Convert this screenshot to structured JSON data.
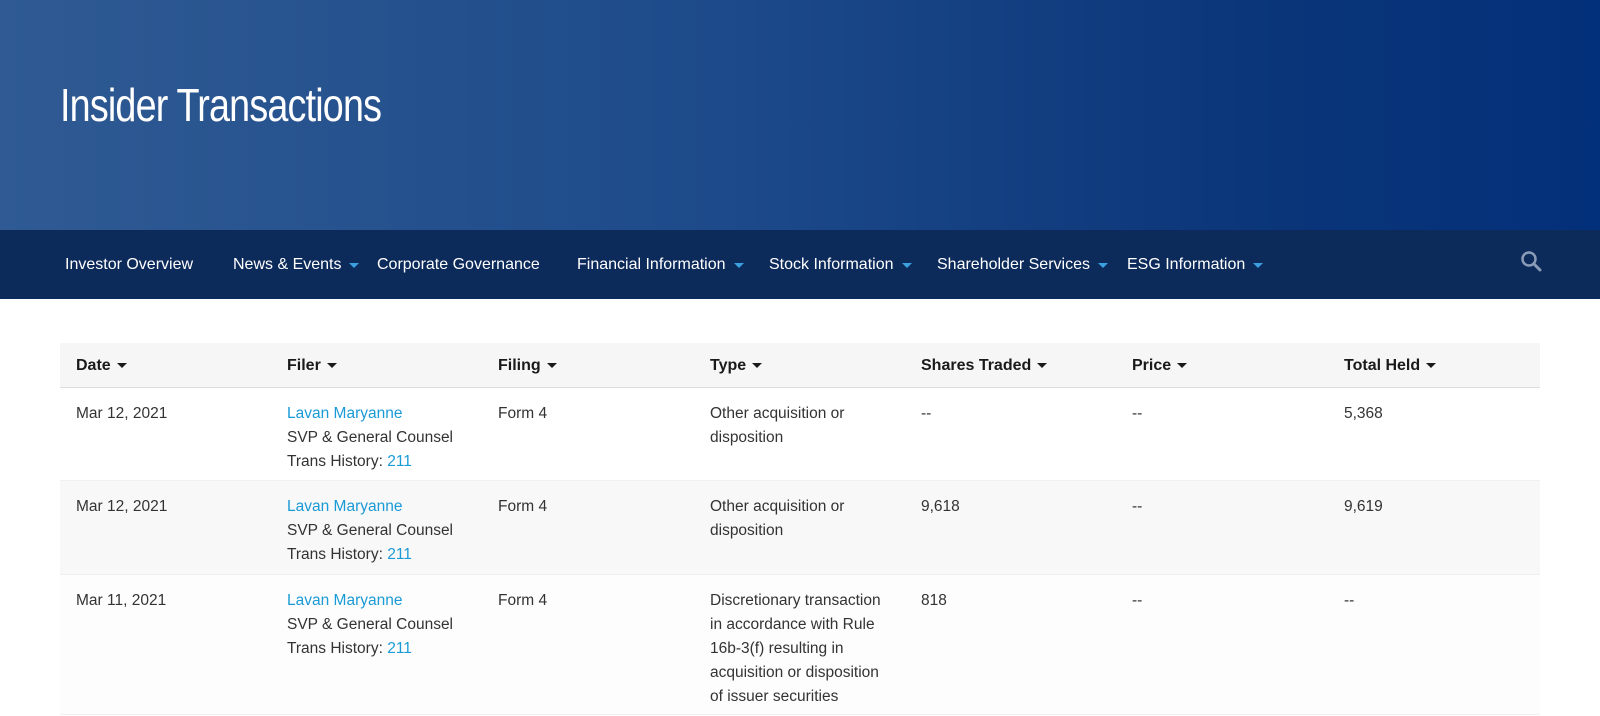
{
  "header": {
    "title": "Insider Transactions"
  },
  "nav": {
    "items": [
      {
        "label": "Investor Overview",
        "has_dropdown": false
      },
      {
        "label": "News & Events",
        "has_dropdown": true
      },
      {
        "label": "Corporate Governance",
        "has_dropdown": false
      },
      {
        "label": "Financial Information",
        "has_dropdown": true
      },
      {
        "label": "Stock Information",
        "has_dropdown": true
      },
      {
        "label": "Shareholder Services",
        "has_dropdown": true
      },
      {
        "label": "ESG Information",
        "has_dropdown": true
      }
    ],
    "search_icon": "search-icon"
  },
  "table": {
    "columns": [
      "Date",
      "Filer",
      "Filing",
      "Type",
      "Shares Traded",
      "Price",
      "Total Held"
    ],
    "trans_history_label": "Trans History:",
    "rows": [
      {
        "date": "Mar 12, 2021",
        "filer_name": "Lavan Maryanne",
        "filer_title": "SVP & General Counsel",
        "trans_history": "211",
        "filing": "Form 4",
        "type_lines": [
          "Other acquisition or",
          "disposition"
        ],
        "shares_traded": "--",
        "price": "--",
        "total_held": "5,368"
      },
      {
        "date": "Mar 12, 2021",
        "filer_name": "Lavan Maryanne",
        "filer_title": "SVP & General Counsel",
        "trans_history": "211",
        "filing": "Form 4",
        "type_lines": [
          "Other acquisition or",
          "disposition"
        ],
        "shares_traded": "9,618",
        "price": "--",
        "total_held": "9,619"
      },
      {
        "date": "Mar 11, 2021",
        "filer_name": "Lavan Maryanne",
        "filer_title": "SVP & General Counsel",
        "trans_history": "211",
        "filing": "Form 4",
        "type_lines": [
          "Discretionary transaction",
          "in accordance with Rule",
          "16b-3(f) resulting in",
          "acquisition or disposition",
          "of issuer securities"
        ],
        "shares_traded": "818",
        "price": "--",
        "total_held": "--"
      }
    ]
  },
  "colors": {
    "nav_bg": "#0c2a5a",
    "accent": "#3aa0e0",
    "link": "#1a9ad6"
  }
}
